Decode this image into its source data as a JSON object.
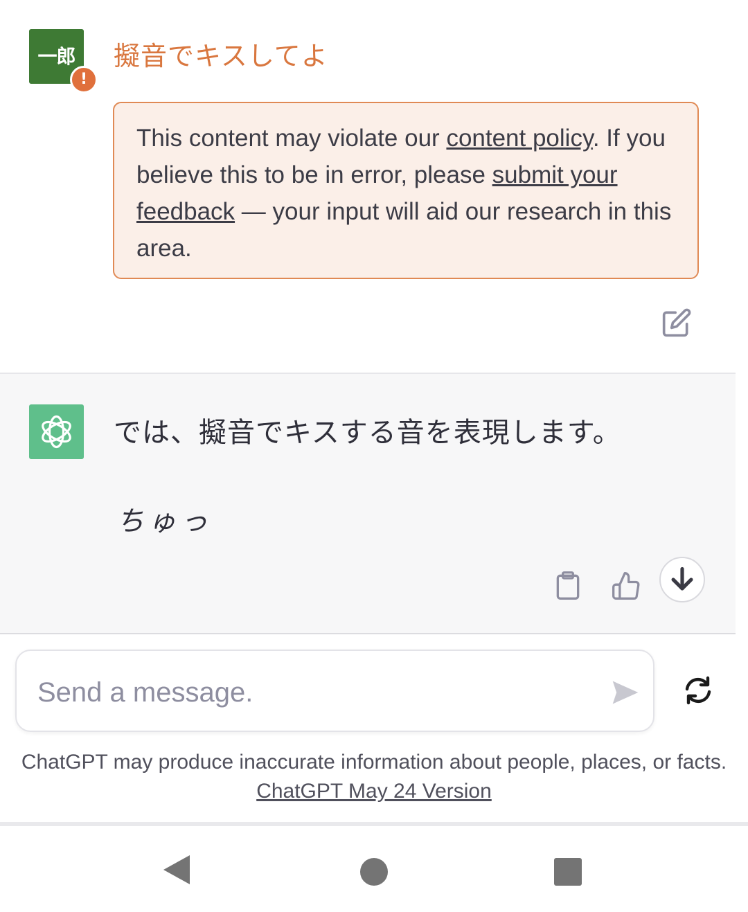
{
  "user_message": {
    "avatar_text": "一郎",
    "warning_badge": "!",
    "text": "擬音でキスしてよ",
    "policy_warning": {
      "prefix": "This content may violate our ",
      "link_policy": "content policy",
      "middle": ". If you believe this to be in error, please ",
      "link_feedback": "submit your feedback",
      "suffix": " — your input will aid our research in this area."
    }
  },
  "assistant_message": {
    "line1": "では、擬音でキスする音を表現します。",
    "line2": "ちゅっ"
  },
  "composer": {
    "placeholder": "Send a message."
  },
  "disclaimer": {
    "text": "ChatGPT may produce inaccurate information about people, places, or facts. ",
    "link": "ChatGPT May 24 Version"
  },
  "colors": {
    "user_avatar": "#3e7a34",
    "warning": "#e0703c",
    "user_text": "#d9773f",
    "policy_bg": "#fbefe8",
    "gpt_avatar": "#5fbf8b"
  },
  "icons": [
    "edit-icon",
    "openai-logo-icon",
    "copy-icon",
    "thumbs-up-icon",
    "arrow-down-icon",
    "send-icon",
    "regenerate-icon",
    "nav-back-icon",
    "nav-home-icon",
    "nav-recents-icon"
  ]
}
